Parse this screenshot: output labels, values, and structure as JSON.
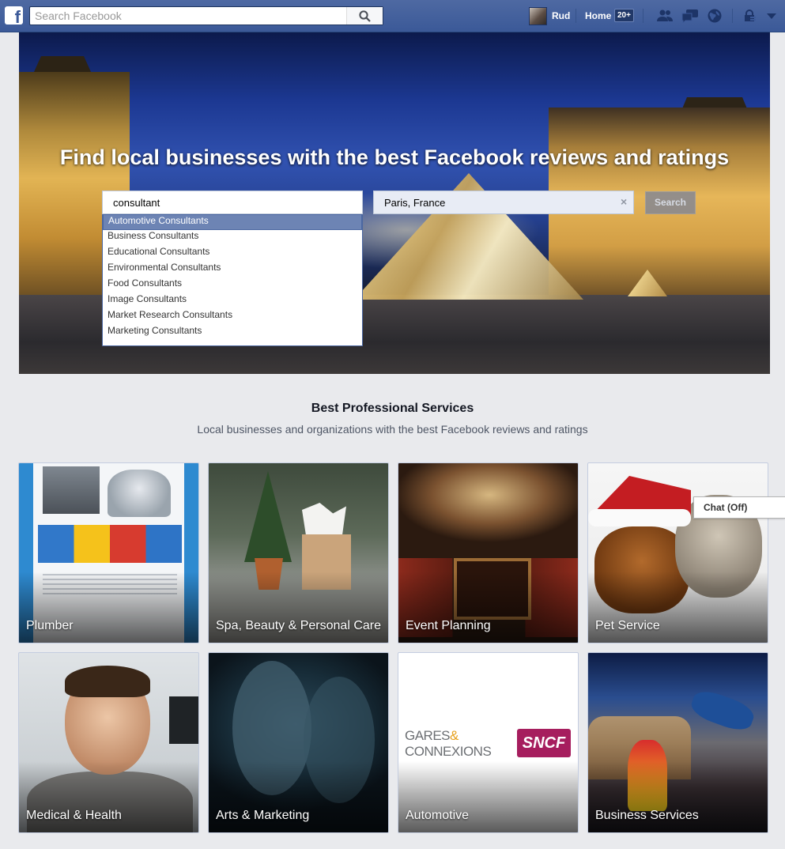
{
  "topbar": {
    "logo": "f",
    "search_placeholder": "Search Facebook",
    "search_icon": "magnifier-icon",
    "user_name": "Rud",
    "home_label": "Home",
    "home_count": "20+",
    "jewels": [
      "friend-requests-icon",
      "messages-icon",
      "notifications-globe-icon",
      "privacy-lock-icon",
      "settings-caret-icon"
    ]
  },
  "hero": {
    "title": "Find local businesses with the best Facebook reviews and ratings",
    "query_value": "consultant",
    "location_value": "Paris, France",
    "clear_symbol": "×",
    "search_button": "Search",
    "suggestions": [
      "Automotive Consultants",
      "Business Consultants",
      "Educational Consultants",
      "Environmental Consultants",
      "Food Consultants",
      "Image Consultants",
      "Market Research Consultants",
      "Marketing Consultants"
    ],
    "selected_index": 0
  },
  "section": {
    "title": "Best Professional Services",
    "subtitle": "Local businesses and organizations with the best Facebook reviews and ratings"
  },
  "categories": [
    "Plumber",
    "Spa, Beauty & Personal Care",
    "Event Planning",
    "Pet Service",
    "Medical & Health",
    "Arts & Marketing",
    "Automotive",
    "Business Services"
  ],
  "tile_images": {
    "gares_line1_a": "GARES",
    "gares_amp": "&",
    "gares_line2": "CONNEXIONS",
    "sncf": "SNCF"
  },
  "chat": {
    "label": "Chat (Off)"
  },
  "colors": {
    "brand_blue": "#3b5998",
    "selected_suggestion": "#6d84b4",
    "page_bg": "#e9eaed"
  }
}
